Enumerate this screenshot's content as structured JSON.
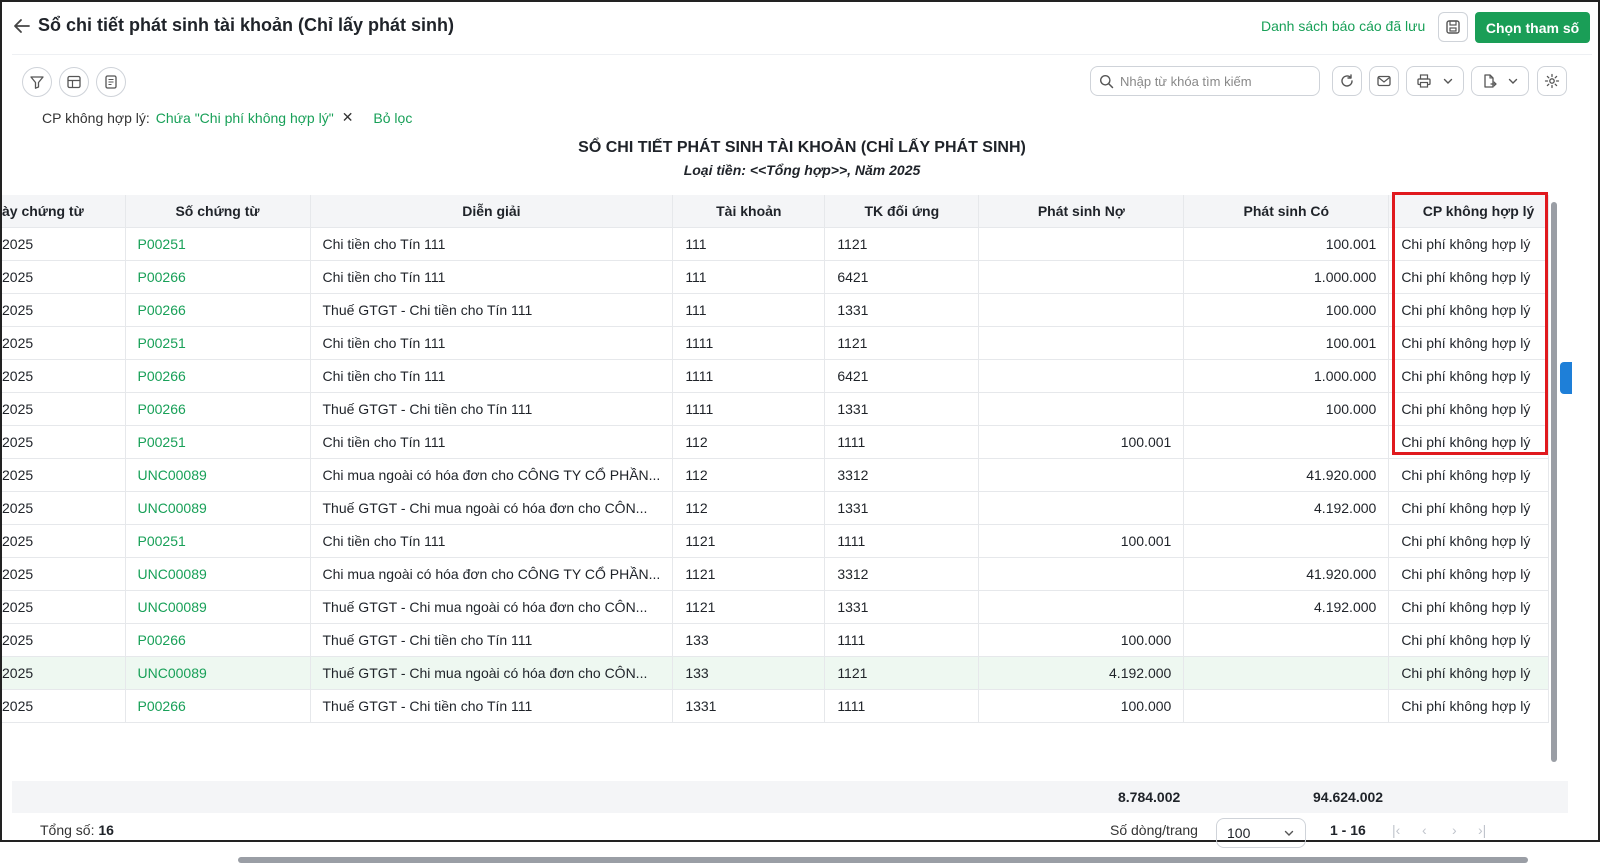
{
  "header": {
    "title": "Sổ chi tiết phát sinh tài khoản (Chỉ lấy phát sinh)",
    "saved_reports": "Danh sách báo cáo đã lưu",
    "choose_params": "Chọn tham số"
  },
  "toolbar": {
    "search_placeholder": "Nhập từ khóa tìm kiếm"
  },
  "filter": {
    "key": "CP không hợp lý:",
    "value": "Chứa \"Chi phí không hợp lý\"",
    "clear": "Bỏ lọc"
  },
  "report": {
    "title": "SỔ CHI TIẾT PHÁT SINH TÀI KHOẢN (CHỈ LẤY PHÁT SINH)",
    "subtitle": "Loại tiền: <<Tổng hợp>>, Năm 2025"
  },
  "columns": {
    "date": "ày chứng từ",
    "doc": "Số chứng từ",
    "desc": "Diễn giải",
    "account": "Tài khoản",
    "counter": "TK đối ứng",
    "debit": "Phát sinh Nợ",
    "credit": "Phát sinh Có",
    "cp": "CP không hợp lý"
  },
  "rows": [
    {
      "date": "2025",
      "doc": "P00251",
      "desc": "Chi tiền cho Tín 111",
      "account": "111",
      "counter": "1121",
      "debit": "",
      "credit": "100.001",
      "cp": "Chi phí không hợp lý"
    },
    {
      "date": "2025",
      "doc": "P00266",
      "desc": "Chi tiền cho Tín 111",
      "account": "111",
      "counter": "6421",
      "debit": "",
      "credit": "1.000.000",
      "cp": "Chi phí không hợp lý"
    },
    {
      "date": "2025",
      "doc": "P00266",
      "desc": "Thuế GTGT - Chi tiền cho Tín 111",
      "account": "111",
      "counter": "1331",
      "debit": "",
      "credit": "100.000",
      "cp": "Chi phí không hợp lý"
    },
    {
      "date": "2025",
      "doc": "P00251",
      "desc": "Chi tiền cho Tín 111",
      "account": "1111",
      "counter": "1121",
      "debit": "",
      "credit": "100.001",
      "cp": "Chi phí không hợp lý"
    },
    {
      "date": "2025",
      "doc": "P00266",
      "desc": "Chi tiền cho Tín 111",
      "account": "1111",
      "counter": "6421",
      "debit": "",
      "credit": "1.000.000",
      "cp": "Chi phí không hợp lý"
    },
    {
      "date": "2025",
      "doc": "P00266",
      "desc": "Thuế GTGT - Chi tiền cho Tín 111",
      "account": "1111",
      "counter": "1331",
      "debit": "",
      "credit": "100.000",
      "cp": "Chi phí không hợp lý"
    },
    {
      "date": "2025",
      "doc": "P00251",
      "desc": "Chi tiền cho Tín 111",
      "account": "112",
      "counter": "1111",
      "debit": "100.001",
      "credit": "",
      "cp": "Chi phí không hợp lý"
    },
    {
      "date": "2025",
      "doc": "UNC00089",
      "desc": "Chi mua ngoài có hóa đơn cho CÔNG TY CỔ PHẦN...",
      "account": "112",
      "counter": "3312",
      "debit": "",
      "credit": "41.920.000",
      "cp": "Chi phí không hợp lý"
    },
    {
      "date": "2025",
      "doc": "UNC00089",
      "desc": "Thuế GTGT - Chi mua ngoài có hóa đơn cho CÔN...",
      "account": "112",
      "counter": "1331",
      "debit": "",
      "credit": "4.192.000",
      "cp": "Chi phí không hợp lý"
    },
    {
      "date": "2025",
      "doc": "P00251",
      "desc": "Chi tiền cho Tín 111",
      "account": "1121",
      "counter": "1111",
      "debit": "100.001",
      "credit": "",
      "cp": "Chi phí không hợp lý"
    },
    {
      "date": "2025",
      "doc": "UNC00089",
      "desc": "Chi mua ngoài có hóa đơn cho CÔNG TY CỔ PHẦN...",
      "account": "1121",
      "counter": "3312",
      "debit": "",
      "credit": "41.920.000",
      "cp": "Chi phí không hợp lý"
    },
    {
      "date": "2025",
      "doc": "UNC00089",
      "desc": "Thuế GTGT - Chi mua ngoài có hóa đơn cho CÔN...",
      "account": "1121",
      "counter": "1331",
      "debit": "",
      "credit": "4.192.000",
      "cp": "Chi phí không hợp lý"
    },
    {
      "date": "2025",
      "doc": "P00266",
      "desc": "Thuế GTGT - Chi tiền cho Tín 111",
      "account": "133",
      "counter": "1111",
      "debit": "100.000",
      "credit": "",
      "cp": "Chi phí không hợp lý"
    },
    {
      "date": "2025",
      "doc": "UNC00089",
      "desc": "Thuế GTGT - Chi mua ngoài có hóa đơn cho CÔN...",
      "account": "133",
      "counter": "1121",
      "debit": "4.192.000",
      "credit": "",
      "cp": "Chi phí không hợp lý"
    },
    {
      "date": "2025",
      "doc": "P00266",
      "desc": "Thuế GTGT - Chi tiền cho Tín 111",
      "account": "1331",
      "counter": "1111",
      "debit": "100.000",
      "credit": "",
      "cp": "Chi phí không hợp lý"
    }
  ],
  "highlighted_row": 13,
  "totals": {
    "debit": "8.784.002",
    "credit": "94.624.002"
  },
  "footer": {
    "total_label": "Tổng số:",
    "total_value": "16",
    "rows_per_page_label": "Số dòng/trang",
    "rows_per_page": "100",
    "range": "1 - 16"
  },
  "colors": {
    "accent": "#1a9e57",
    "link": "#18a058",
    "highlight_box": "#e0191e"
  }
}
